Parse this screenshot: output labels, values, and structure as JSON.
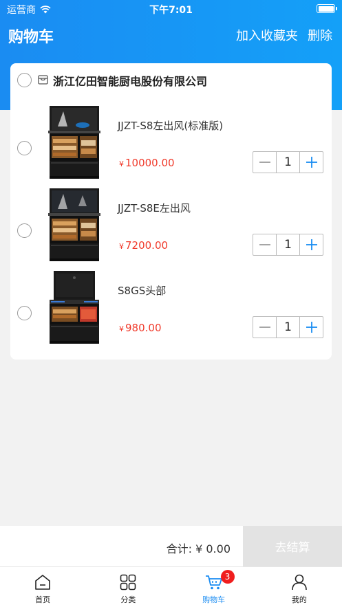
{
  "status_bar": {
    "carrier": "运营商",
    "time": "下午7:01"
  },
  "header": {
    "title": "购物车",
    "actions": {
      "favorite": "加入收藏夹",
      "delete": "删除"
    }
  },
  "shop": {
    "name": "浙江亿田智能厨电股份有限公司"
  },
  "items": [
    {
      "title": "JJZT-S8左出风(标准版)",
      "currency": "¥",
      "price": "10000.00",
      "qty": "1"
    },
    {
      "title": "JJZT-S8E左出风",
      "currency": "¥",
      "price": "7200.00",
      "qty": "1"
    },
    {
      "title": "S8GS头部",
      "currency": "¥",
      "price": "980.00",
      "qty": "1"
    }
  ],
  "checkout": {
    "total": "合计: ¥ 0.00",
    "button": "去结算"
  },
  "tabbar": {
    "tabs": [
      {
        "label": "首页",
        "icon": "home-icon"
      },
      {
        "label": "分类",
        "icon": "category-icon"
      },
      {
        "label": "购物车",
        "icon": "cart-icon",
        "badge": "3",
        "active": true
      },
      {
        "label": "我的",
        "icon": "user-icon"
      }
    ]
  },
  "colors": {
    "primary": "#1a8cf2",
    "price": "#f03a2b",
    "badge": "#f01e1e"
  }
}
